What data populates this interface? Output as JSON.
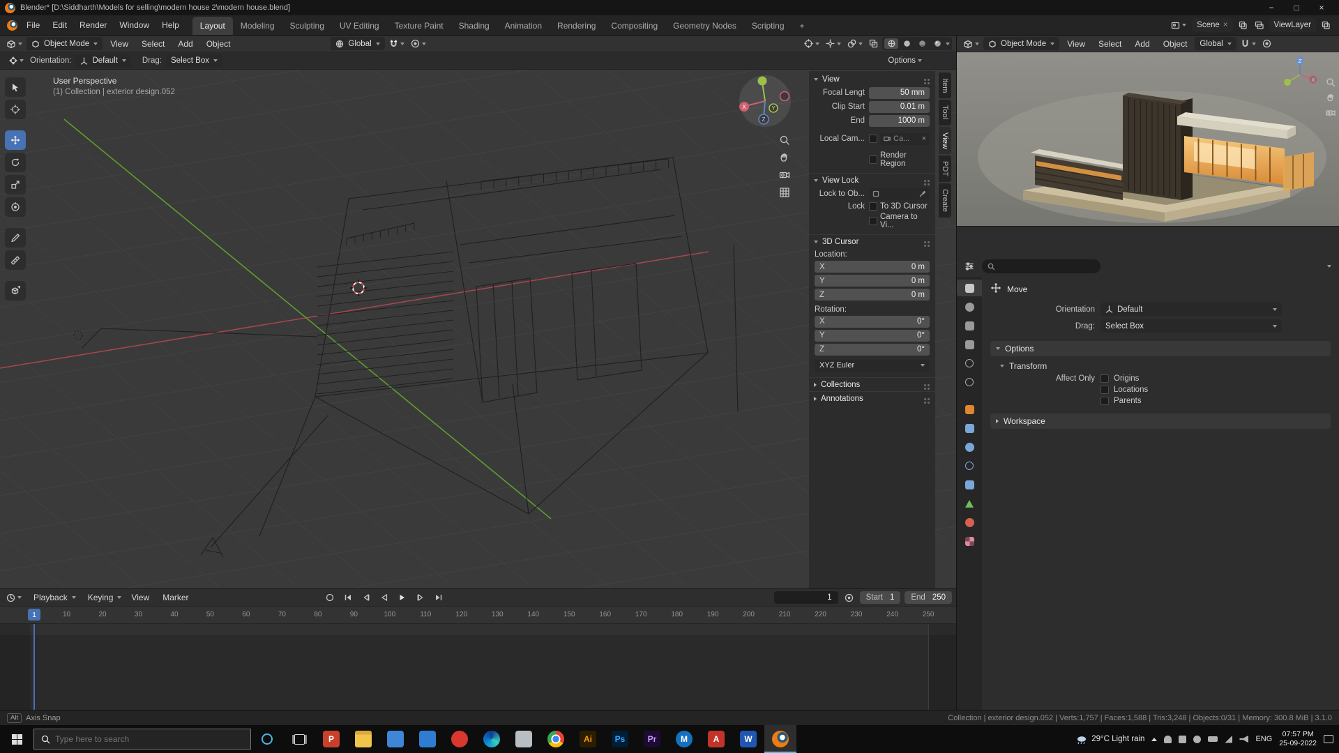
{
  "colors": {
    "accent": "#4772b3",
    "axis_x": "#b8434e",
    "axis_y": "#5f9e2e",
    "viewport_bg": "#3a3a3a",
    "glow": "#e8a44f"
  },
  "titlebar": {
    "title": "Blender* [D:\\Siddharth\\Models for selling\\modern house 2\\modern house.blend]"
  },
  "topbar": {
    "menus": [
      "File",
      "Edit",
      "Render",
      "Window",
      "Help"
    ],
    "workspaces": [
      "Layout",
      "Modeling",
      "Sculpting",
      "UV Editing",
      "Texture Paint",
      "Shading",
      "Animation",
      "Rendering",
      "Compositing",
      "Geometry Nodes",
      "Scripting"
    ],
    "scene_label": "Scene",
    "viewlayer_label": "ViewLayer"
  },
  "viewport": {
    "mode": "Object Mode",
    "menu_view": "View",
    "menu_select": "Select",
    "menu_add": "Add",
    "menu_object": "Object",
    "transform_orientation": "Global",
    "tool_orientation_label": "Orientation:",
    "tool_orientation_value": "Default",
    "tool_drag_label": "Drag:",
    "tool_drag_value": "Select Box",
    "options_label": "Options",
    "overlay_line1": "User Perspective",
    "overlay_line2": "(1) Collection | exterior design.052",
    "gizmo": {
      "x": "X",
      "y": "Y",
      "z": "Z"
    }
  },
  "sidebar": {
    "tabs": [
      "Item",
      "Tool",
      "View",
      "PDT",
      "Create"
    ],
    "view": {
      "title": "View",
      "focal_label": "Focal Lengt",
      "focal_value": "50 mm",
      "clip_start_label": "Clip Start",
      "clip_start_value": "0.01 m",
      "clip_end_label": "End",
      "clip_end_value": "1000 m",
      "local_camera_label": "Local Cam...",
      "local_camera_value": "Ca...",
      "render_region_label": "Render Region"
    },
    "view_lock": {
      "title": "View Lock",
      "lock_to_object_label": "Lock to Ob...",
      "lock_label": "Lock",
      "to_3d_cursor_label": "To 3D Cursor",
      "camera_to_view_label": "Camera to Vi..."
    },
    "cursor3d": {
      "title": "3D Cursor",
      "location_label": "Location:",
      "rotation_label": "Rotation:",
      "loc_x_axis": "X",
      "loc_x": "0 m",
      "loc_y_axis": "Y",
      "loc_y": "0 m",
      "loc_z_axis": "Z",
      "loc_z": "0 m",
      "rot_x_axis": "X",
      "rot_x": "0°",
      "rot_y_axis": "Y",
      "rot_y": "0°",
      "rot_z_axis": "Z",
      "rot_z": "0°",
      "euler": "XYZ Euler"
    },
    "collections_title": "Collections",
    "annotations_title": "Annotations"
  },
  "preview": {
    "mode": "Object Mode",
    "menu_view": "View",
    "menu_select": "Select",
    "menu_add": "Add",
    "menu_object": "Object",
    "transform_orientation": "Global",
    "gizmo": {
      "x": "X",
      "z": "Z"
    }
  },
  "properties": {
    "tool_title": "Move",
    "orientation_label": "Orientation",
    "orientation_value": "Default",
    "drag_label": "Drag:",
    "drag_value": "Select Box",
    "options_title": "Options",
    "transform_title": "Transform",
    "affect_only_label": "Affect Only",
    "checkbox_origins": "Origins",
    "checkbox_locations": "Locations",
    "checkbox_parents": "Parents",
    "workspace_title": "Workspace",
    "tabs": [
      {
        "name": "tool",
        "shape": "rect",
        "color": "#c8c8c8",
        "active": true
      },
      {
        "name": "render",
        "shape": "circle",
        "color": "#9a9a9a"
      },
      {
        "name": "output",
        "shape": "rect",
        "color": "#9a9a9a"
      },
      {
        "name": "view-layer",
        "shape": "rect",
        "color": "#9a9a9a"
      },
      {
        "name": "scene",
        "shape": "outline",
        "color": "#a8a8a8"
      },
      {
        "name": "world",
        "shape": "outline",
        "color": "#a8a8a8"
      },
      {
        "name": "object",
        "shape": "rect",
        "color": "#e0862c",
        "gap": true
      },
      {
        "name": "modifiers",
        "shape": "rect",
        "color": "#7aa7d8"
      },
      {
        "name": "particles",
        "shape": "circle",
        "color": "#7aa7d8"
      },
      {
        "name": "physics",
        "shape": "outline",
        "color": "#7aa7d8"
      },
      {
        "name": "constraints",
        "shape": "rect",
        "color": "#7aa7d8"
      },
      {
        "name": "object-data",
        "shape": "triangle",
        "color": "#6fbf57"
      },
      {
        "name": "material",
        "shape": "circle",
        "color": "#d8604f"
      },
      {
        "name": "texture",
        "shape": "checker",
        "color": "#e08aa0"
      }
    ]
  },
  "timeline": {
    "menu_playback": "Playback",
    "menu_keying": "Keying",
    "menu_view": "View",
    "menu_marker": "Marker",
    "current_frame": "1",
    "start_label": "Start",
    "start_value": "1",
    "end_label": "End",
    "end_value": "250",
    "playhead_frame": "1",
    "ticks": [
      10,
      20,
      30,
      40,
      50,
      60,
      70,
      80,
      90,
      100,
      110,
      120,
      130,
      140,
      150,
      160,
      170,
      180,
      190,
      200,
      210,
      220,
      230,
      240,
      250
    ]
  },
  "statusbar": {
    "left_key": "Alt",
    "left_text": "Axis Snap",
    "right_text": "Collection | exterior design.052 | Verts:1,757 | Faces:1,588 | Tris:3,248 | Objects:0/31 | Memory: 300.8 MiB | 3.1.0"
  },
  "taskbar": {
    "search_placeholder": "Type here to search",
    "weather": "29°C Light rain",
    "language": "ENG",
    "time": "07:57 PM",
    "date": "25-09-2022",
    "apps": [
      {
        "name": "powerpoint",
        "glyph": "P",
        "bg": "#c8402a",
        "fg": "#ffffff"
      },
      {
        "name": "file-explorer",
        "glyph": "",
        "bg": "#f2c44c",
        "fg": "#6b4b12",
        "shape": "folder"
      },
      {
        "name": "mail",
        "glyph": "",
        "bg": "#3f86d6",
        "fg": "#ffffff"
      },
      {
        "name": "store",
        "glyph": "",
        "bg": "#2f7cd3",
        "fg": "#ffffff"
      },
      {
        "name": "media-player",
        "glyph": "",
        "bg": "#d8382e",
        "fg": "#ffffff",
        "shape": "circle"
      },
      {
        "name": "edge",
        "glyph": "",
        "bg": "",
        "fg": "#ffffff",
        "shape": "edge"
      },
      {
        "name": "files-app",
        "glyph": "",
        "bg": "#b9bec4",
        "fg": "#40454d"
      },
      {
        "name": "chrome",
        "glyph": "",
        "bg": "",
        "fg": "#ffffff",
        "shape": "chrome"
      },
      {
        "name": "illustrator",
        "glyph": "Ai",
        "bg": "#2b1e00",
        "fg": "#ff9a00"
      },
      {
        "name": "photoshop",
        "glyph": "Ps",
        "bg": "#001e36",
        "fg": "#31a8ff"
      },
      {
        "name": "premiere",
        "glyph": "Pr",
        "bg": "#1d0b33",
        "fg": "#c79bff"
      },
      {
        "name": "malwarebytes",
        "glyph": "M",
        "bg": "#1570c0",
        "fg": "#ffffff",
        "shape": "circle"
      },
      {
        "name": "autodesk",
        "glyph": "A",
        "bg": "#c2342a",
        "fg": "#ffffff"
      },
      {
        "name": "word",
        "glyph": "W",
        "bg": "#1f56b0",
        "fg": "#ffffff"
      },
      {
        "name": "blender",
        "glyph": "",
        "bg": "",
        "fg": "#ffffff",
        "shape": "blender",
        "active": true
      }
    ]
  }
}
